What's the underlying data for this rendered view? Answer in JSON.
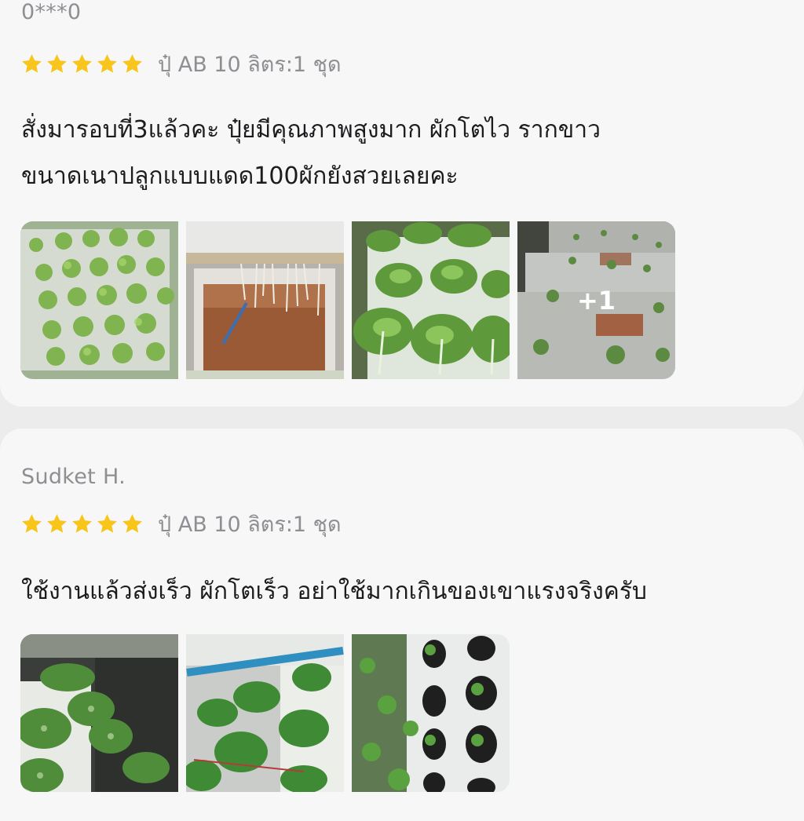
{
  "colors": {
    "star": "#f8c51c",
    "username": "#8e8e93",
    "text": "#1c1c1e"
  },
  "reviews": [
    {
      "username": "0***0",
      "rating": 5,
      "variant": "ปุ๋ AB 10 ลิตร:1 ชุด",
      "text_lines": [
        "สั่งมารอบที่3แล้วคะ ปุ๋ยมีคุณภาพสูงมาก ผักโตไว รากขาว",
        "ขนาดเนาปลูกแบบแดด100ผักยังสวยเลยคะ"
      ],
      "more_photos": "+1"
    },
    {
      "username": "Sudket H.",
      "rating": 5,
      "variant": "ปุ๋ AB 10 ลิตร:1 ชุด",
      "text_lines": [
        "ใช้งานแล้วส่งเร็ว ผักโตเร็ว อย่าใช้มากเกินของเขาแรงจริงครับ"
      ]
    }
  ]
}
